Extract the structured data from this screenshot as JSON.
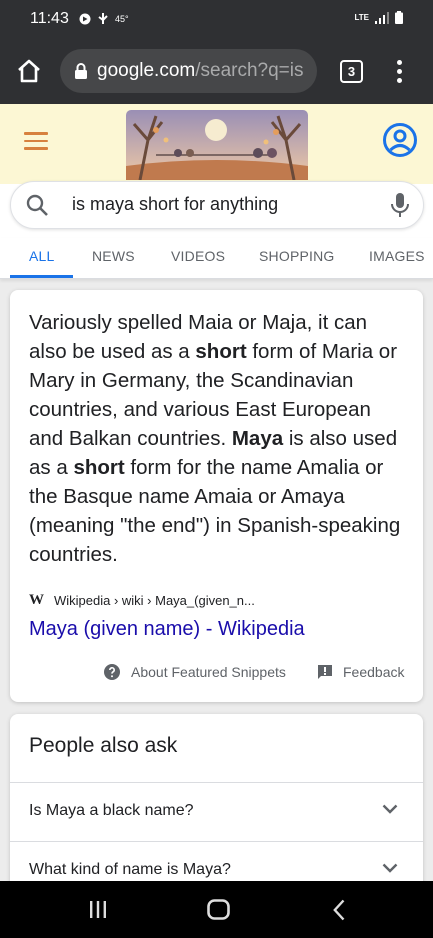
{
  "status_bar": {
    "time": "11:43",
    "temperature": "45°",
    "network": "LTE"
  },
  "browser": {
    "url_domain": "google.com",
    "url_path": "/search?q=is",
    "tab_count": "3"
  },
  "search": {
    "query": "is maya short for anything"
  },
  "tabs": [
    {
      "label": "ALL",
      "active": true
    },
    {
      "label": "NEWS",
      "active": false
    },
    {
      "label": "VIDEOS",
      "active": false
    },
    {
      "label": "SHOPPING",
      "active": false
    },
    {
      "label": "IMAGES",
      "active": false
    }
  ],
  "snippet": {
    "segments": [
      {
        "text": "Variously spelled Maia or Maja, it can also be used as a ",
        "bold": false
      },
      {
        "text": "short",
        "bold": true
      },
      {
        "text": " form of Maria or Mary in Germany, the Scandinavian countries, and various East European and Balkan countries. ",
        "bold": false
      },
      {
        "text": "Maya",
        "bold": true
      },
      {
        "text": " is also used as a ",
        "bold": false
      },
      {
        "text": "short",
        "bold": true
      },
      {
        "text": " form for the name Amalia or the Basque name Amaia or Amaya (meaning \"the end\") in Spanish-speaking countries.",
        "bold": false
      }
    ],
    "source_icon": "W",
    "source_path": "Wikipedia › wiki › Maya_(given_n...",
    "link_title": "Maya (given name) - Wikipedia",
    "about_label": "About Featured Snippets",
    "feedback_label": "Feedback"
  },
  "people_also_ask": {
    "title": "People also ask",
    "questions": [
      "Is Maya a black name?",
      "What kind of name is Maya?"
    ]
  },
  "colors": {
    "accent": "#1a73e8",
    "link": "#1a0dab",
    "doodle_bg": "#fcf7d4",
    "hamburger": "#d7813e"
  }
}
